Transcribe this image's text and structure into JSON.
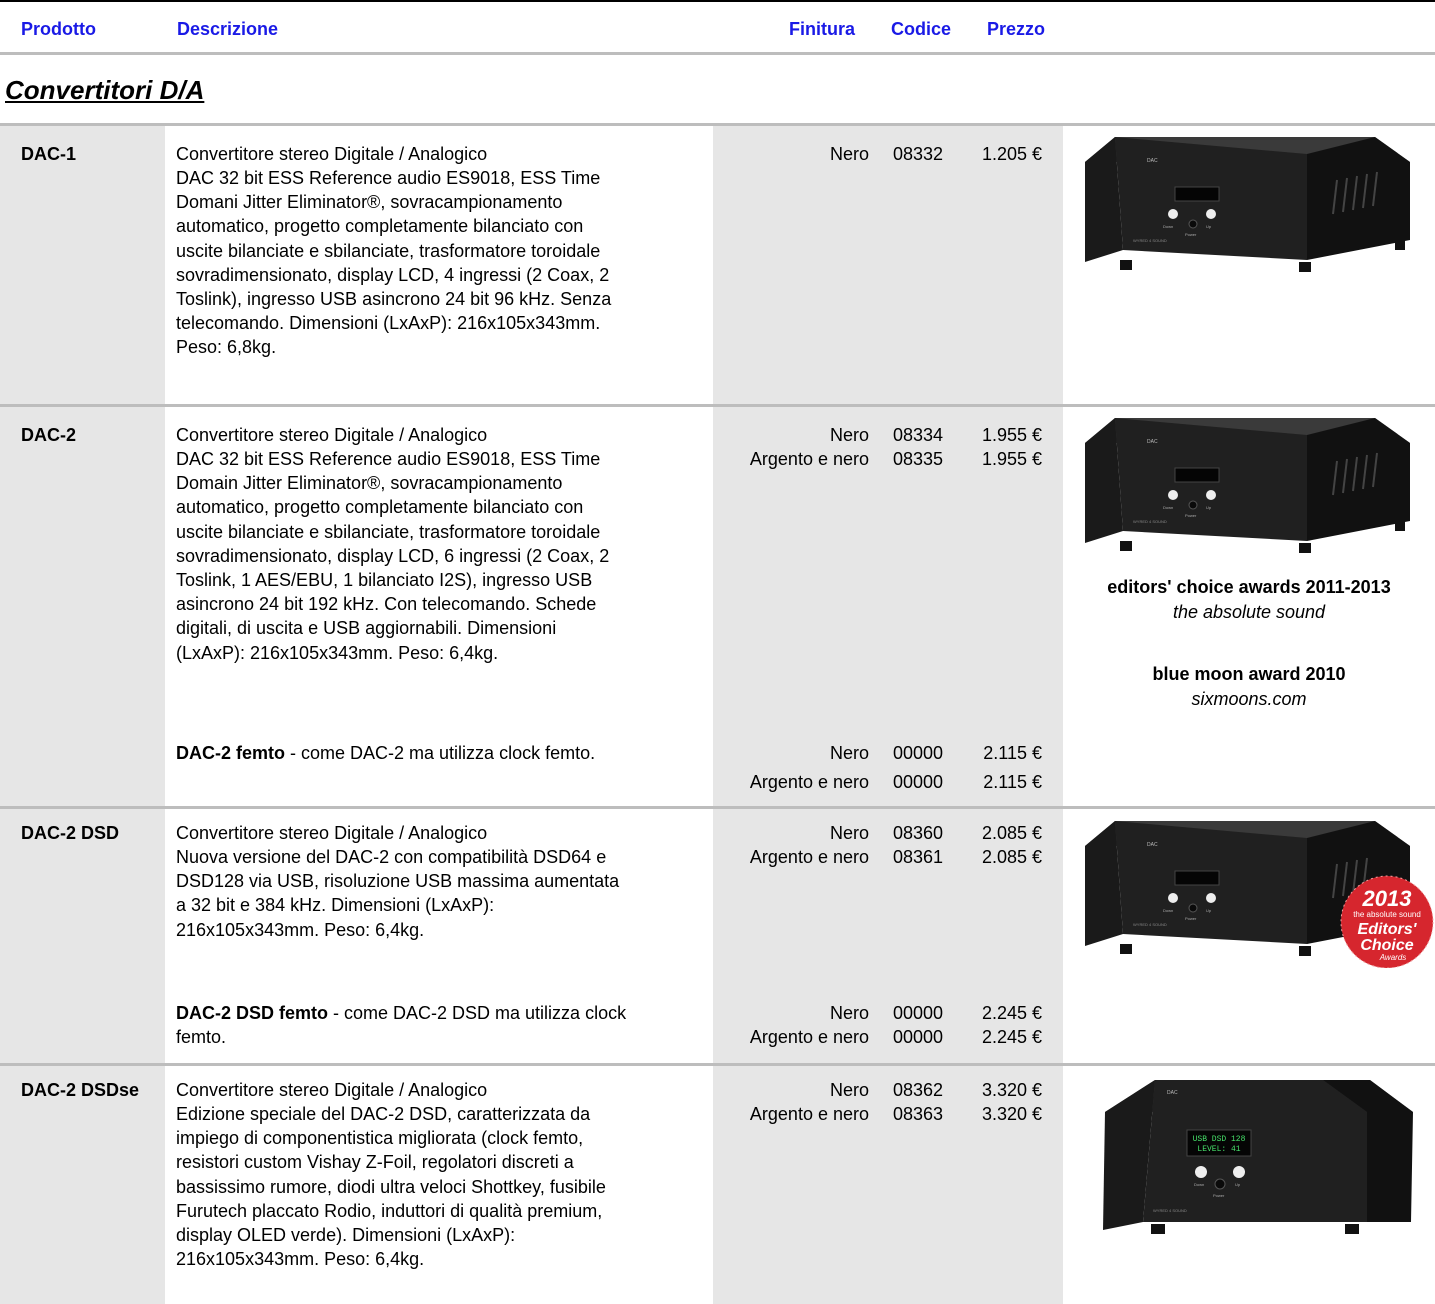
{
  "header": {
    "prodotto": "Prodotto",
    "descrizione": "Descrizione",
    "finitura": "Finitura",
    "codice": "Codice",
    "prezzo": "Prezzo"
  },
  "section_title": "Convertitori D/A",
  "rows": [
    {
      "name": "DAC-1",
      "title": "Convertitore stereo Digitale / Analogico",
      "description": "DAC 32 bit ESS Reference audio ES9018, ESS Time\nDomani Jitter Eliminator®, sovracampionamento\nautomatico, progetto completamente bilanciato con\nuscite bilanciate e sbilanciate, trasformatore toroidale\nsovradimensionato, display LCD, 4 ingressi (2 Coax, 2\nToslink), ingresso USB asincrono 24 bit 96 kHz. Senza\ntelecomando. Dimensioni (LxAxP): 216x105x343mm.\nPeso: 6,8kg.",
      "options": [
        {
          "finish": "Nero",
          "code": "08332",
          "price": "1.205 €"
        }
      ]
    },
    {
      "name": "DAC-2",
      "title": "Convertitore stereo Digitale / Analogico",
      "description": "DAC 32 bit ESS Reference audio ES9018, ESS Time\nDomain Jitter Eliminator®, sovracampionamento\nautomatico, progetto completamente bilanciato con\nuscite bilanciate e sbilanciate, trasformatore toroidale\nsovradimensionato, display LCD, 6 ingressi (2 Coax, 2\nToslink, 1 AES/EBU, 1 bilanciato I2S), ingresso USB\nasincrono 24 bit 192 kHz. Con telecomando. Schede\ndigitali, di uscita e USB aggiornabili. Dimensioni\n(LxAxP): 216x105x343mm. Peso: 6,4kg.",
      "options": [
        {
          "finish": "Nero",
          "code": "08334",
          "price": "1.955 €"
        },
        {
          "finish": "Argento e nero",
          "code": "08335",
          "price": "1.955 €"
        }
      ],
      "variant": {
        "name": "DAC-2 femto",
        "text": " - come DAC-2 ma utilizza clock femto.",
        "options": [
          {
            "finish": "Nero",
            "code": "00000",
            "price": "2.115 €"
          },
          {
            "finish": "Argento e nero",
            "code": "00000",
            "price": "2.115 €"
          }
        ]
      },
      "awards": [
        {
          "title": "editors' choice awards 2011-2013",
          "source": "the absolute sound"
        },
        {
          "title": "blue moon award 2010",
          "source": "sixmoons.com"
        }
      ]
    },
    {
      "name": "DAC-2 DSD",
      "title": "Convertitore stereo Digitale / Analogico",
      "description": "Nuova versione del DAC-2 con compatibilità DSD64 e\nDSD128 via USB, risoluzione USB massima aumentata\na 32 bit e 384 kHz. Dimensioni (LxAxP):\n216x105x343mm. Peso: 6,4kg.",
      "options": [
        {
          "finish": "Nero",
          "code": "08360",
          "price": "2.085 €"
        },
        {
          "finish": "Argento e nero",
          "code": "08361",
          "price": "2.085 €"
        }
      ],
      "variant": {
        "name": "DAC-2 DSD femto",
        "text": " - come DAC-2 DSD ma utilizza clock\nfemto.",
        "options": [
          {
            "finish": "Nero",
            "code": "00000",
            "price": "2.245 €"
          },
          {
            "finish": "Argento e nero",
            "code": "00000",
            "price": "2.245 €"
          }
        ]
      },
      "badge": {
        "year": "2013",
        "line1": "the absolute sound",
        "line2": "Editors'",
        "line3": "Choice",
        "line4": "Awards"
      }
    },
    {
      "name": "DAC-2 DSDse",
      "title": "Convertitore stereo Digitale / Analogico",
      "description": "Edizione speciale del DAC-2 DSD, caratterizzata da\nimpiego di componentistica migliorata (clock femto,\nresistori custom Vishay Z-Foil, regolatori discreti a\nbassissimo rumore, diodi ultra veloci Shottkey, fusibile\nFurutech placcato Rodio, induttori di qualità premium,\ndisplay OLED verde). Dimensioni (LxAxP):\n216x105x343mm. Peso: 6,4kg.",
      "options": [
        {
          "finish": "Nero",
          "code": "08362",
          "price": "3.320 €"
        },
        {
          "finish": "Argento e nero",
          "code": "08363",
          "price": "3.320 €"
        }
      ],
      "oled": {
        "line1": "USB DSD 128",
        "line2": "LEVEL: 41"
      }
    }
  ],
  "device": {
    "brand": "DAC",
    "down": "Down",
    "up": "Up",
    "power": "Power",
    "maker": "WYRED 4 SOUND"
  }
}
